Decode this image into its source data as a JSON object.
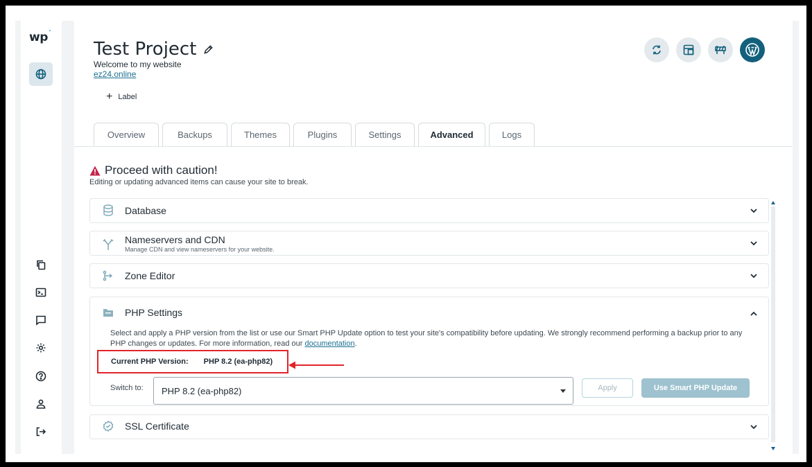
{
  "sidebar": {
    "logo_text": "wp",
    "logo_mark": "˙",
    "items": [
      {
        "icon": "globe-icon",
        "active": true
      },
      {
        "icon": "copy-icon"
      },
      {
        "icon": "terminal-icon"
      },
      {
        "icon": "chat-icon"
      },
      {
        "icon": "gear-icon"
      },
      {
        "icon": "help-icon"
      },
      {
        "icon": "user-icon"
      },
      {
        "icon": "logout-icon"
      }
    ]
  },
  "header": {
    "title": "Test Project",
    "subtitle": "Welcome to my website",
    "domain": "ez24.online",
    "label_button": "Label",
    "action_icons": [
      "sync-icon",
      "staging-icon",
      "maintenance-icon",
      "wordpress-icon"
    ]
  },
  "tabs": [
    {
      "label": "Overview"
    },
    {
      "label": "Backups"
    },
    {
      "label": "Themes"
    },
    {
      "label": "Plugins"
    },
    {
      "label": "Settings"
    },
    {
      "label": "Advanced",
      "active": true
    },
    {
      "label": "Logs"
    }
  ],
  "caution": {
    "title": "Proceed with caution!",
    "subtitle": "Editing or updating advanced items can cause your site to break."
  },
  "sections": {
    "database": {
      "title": "Database"
    },
    "nameservers": {
      "title": "Nameservers and CDN",
      "subtitle": "Manage CDN and view nameservers for your website."
    },
    "zone_editor": {
      "title": "Zone Editor"
    },
    "php": {
      "title": "PHP Settings",
      "description": "Select and apply a PHP version from the list or use our Smart PHP Update option to test your site's compatibility before updating. We strongly recommend performing a backup prior to any PHP changes or updates. For more information, read our",
      "doc_link": "documentation",
      "period": ".",
      "current_label": "Current PHP Version:",
      "current_value": "PHP 8.2 (ea-php82)",
      "switch_label": "Switch to:",
      "selected": "PHP 8.2 (ea-php82)",
      "apply": "Apply",
      "smart_update": "Use Smart PHP Update"
    },
    "ssl": {
      "title": "SSL Certificate"
    }
  },
  "colors": {
    "accent": "#13607c",
    "link": "#1b6f91",
    "warning": "#c4244b",
    "highlight_box": "#e2232a"
  }
}
